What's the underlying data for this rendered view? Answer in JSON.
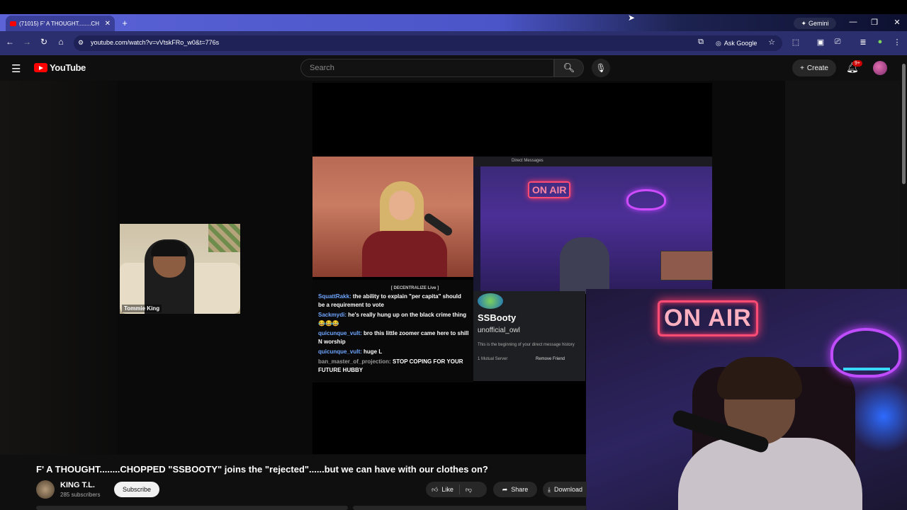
{
  "browser": {
    "tab_title": "(71015) F' A THOUGHT........CH",
    "tab_close": "✕",
    "new_tab": "+",
    "gemini_label": "Gemini",
    "url": "youtube.com/watch?v=vVtskFRo_w0&t=776s",
    "ask_google": "Ask Google",
    "window_controls": [
      "—",
      "❐",
      "✕"
    ]
  },
  "youtube": {
    "logo_text": "YouTube",
    "search_placeholder": "Search",
    "create_label": "Create",
    "notifications_badge": "9+"
  },
  "video": {
    "overlay_name": "Tommie King",
    "discord_header": "Direct Messages",
    "onair_small": "ON AIR",
    "onair_big": "ON AIR",
    "profile": {
      "name": "SSBooty",
      "username": "unofficial_owl",
      "description": "This is the beginning of your direct message history",
      "mutual": "1 Mutual Server",
      "remove": "Remove Friend"
    },
    "chat_header": "[ DECENTRALIZE Live ]",
    "chat": [
      {
        "user": "SquattRakk:",
        "text": "the ability to explain \"per capita\" should be a requirement to vote"
      },
      {
        "user": "Sackmydi:",
        "text": "he's really hung up on the black crime thing 😂😂😂"
      },
      {
        "user": "quicunque_vult:",
        "text": "bro this little zoomer came here to shill N worship"
      },
      {
        "user": "quicunque_vult:",
        "text": "huge L"
      },
      {
        "user": "ban_master_of_projection:",
        "text": "STOP COPING FOR YOUR FUTURE HUBBY"
      }
    ]
  },
  "below_video": {
    "title": "F' A THOUGHT........CHOPPED \"SSBOOTY\" joins the \"rejected\"......but we can have with our clothes on?",
    "channel_name": "KING T.L.",
    "subscribers": "285 subscribers",
    "subscribe_label": "Subscribe",
    "like_label": "Like",
    "share_label": "Share",
    "download_label": "Download"
  },
  "colors": {
    "youtube_red": "#ff0000",
    "neon_pink": "#ff4c74",
    "neon_purple": "#c04cff",
    "chat_user": "#6ea6ff"
  }
}
